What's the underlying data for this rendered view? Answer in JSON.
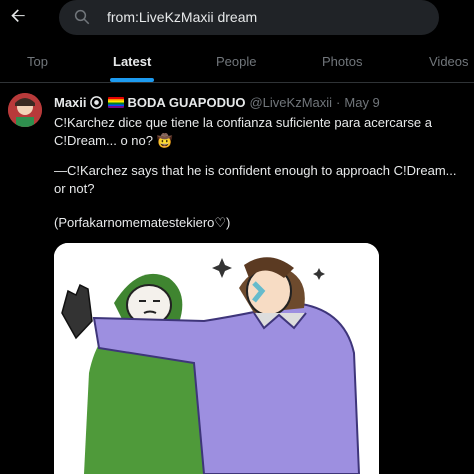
{
  "search": {
    "query": "from:LiveKzMaxii dream",
    "icon": "search-icon"
  },
  "nav": {
    "back_icon": "arrow-left-icon"
  },
  "tabs": [
    {
      "label": "Top",
      "active": false
    },
    {
      "label": "Latest",
      "active": true
    },
    {
      "label": "People",
      "active": false
    },
    {
      "label": "Photos",
      "active": false
    },
    {
      "label": "Videos",
      "active": false
    }
  ],
  "tweet": {
    "author_name": "Maxii",
    "display_name_suffix": "BODA GUAPODUO",
    "handle": "@LiveKzMaxii",
    "separator": "·",
    "date": "May 9",
    "text_line1": "C!Karchez dice que tiene la confianza suficiente para acercarse a C!Dream... o no? 🤠",
    "text_line2": "—C!Karchez says that he is confident enough to approach C!Dream... or not?",
    "text_line3": "(Porfakarnomematestekiero♡)"
  },
  "colors": {
    "accent": "#1d9bf0",
    "background": "#000000",
    "muted": "#71767b"
  }
}
